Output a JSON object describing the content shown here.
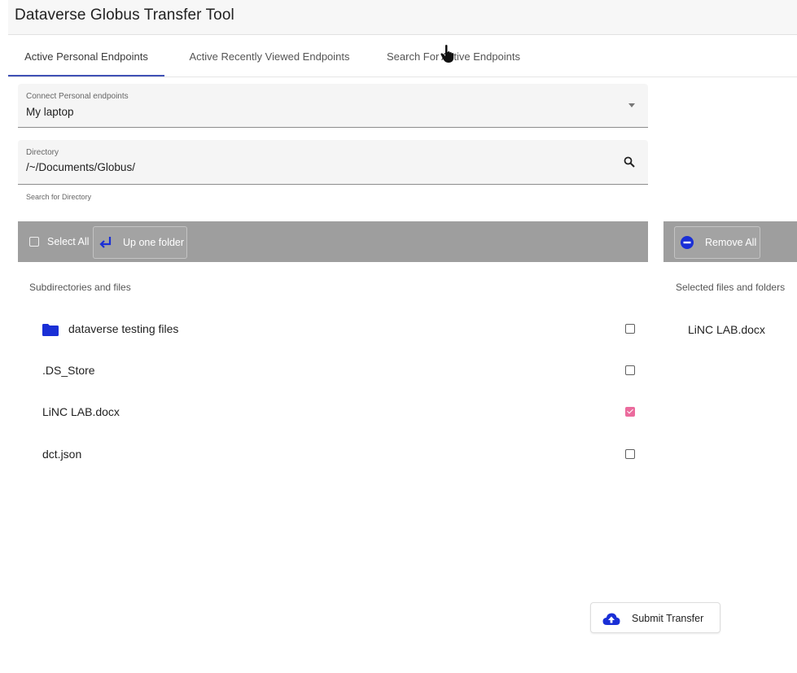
{
  "app": {
    "title": "Dataverse Globus Transfer Tool"
  },
  "tabs": [
    {
      "label": "Active Personal Endpoints",
      "active": true
    },
    {
      "label": "Active Recently Viewed Endpoints",
      "active": false
    },
    {
      "label": "Search For Active Endpoints",
      "active": false
    }
  ],
  "endpoint_select": {
    "label": "Connect Personal endpoints",
    "value": "My laptop"
  },
  "directory": {
    "label": "Directory",
    "value": "/~/Documents/Globus/",
    "hint": "Search for Directory"
  },
  "left_toolbar": {
    "select_all_label": "Select All",
    "up_folder_label": "Up one folder"
  },
  "right_toolbar": {
    "remove_all_label": "Remove All"
  },
  "files_section": {
    "heading": "Subdirectories and files",
    "items": [
      {
        "name": "dataverse testing files",
        "type": "folder",
        "checked": false
      },
      {
        "name": ".DS_Store",
        "type": "file",
        "checked": false
      },
      {
        "name": "LiNC LAB.docx",
        "type": "file",
        "checked": true
      },
      {
        "name": "dct.json",
        "type": "file",
        "checked": false
      }
    ]
  },
  "selected_section": {
    "heading": "Selected files and folders",
    "items": [
      {
        "name": "LiNC LAB.docx"
      }
    ]
  },
  "submit": {
    "label": "Submit Transfer"
  },
  "colors": {
    "accent": "#3f51b5",
    "icon_blue": "#1a2fd6",
    "checked": "#e8528c",
    "toolbar": "#9e9e9e"
  }
}
